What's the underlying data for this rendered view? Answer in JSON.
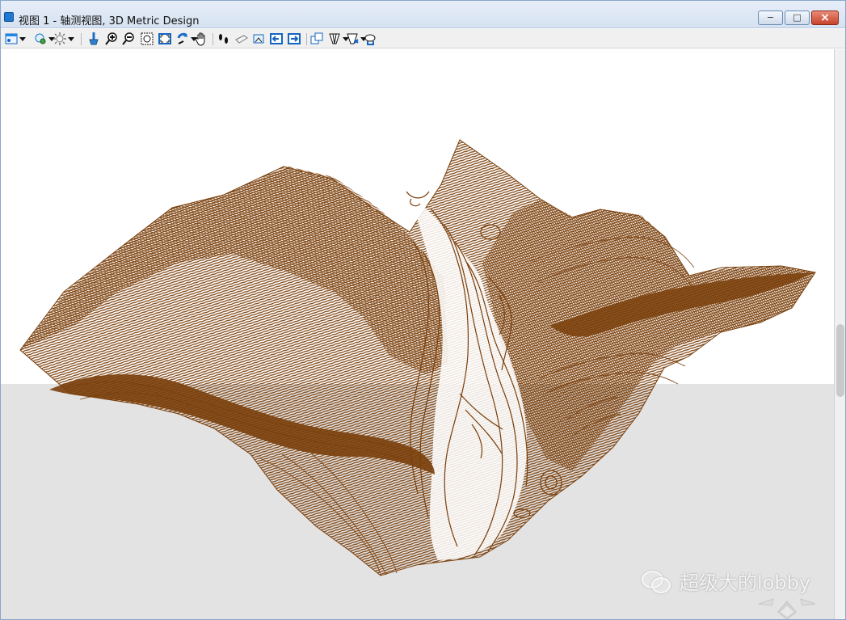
{
  "window": {
    "title": "视图 1 - 轴测视图, 3D Metric Design",
    "controls": {
      "minimize": "−",
      "maximize": "□",
      "close": "×"
    }
  },
  "toolbar": {
    "icons": [
      "view-settings-icon",
      "view-display-icon",
      "brightness-icon",
      "clear-icon",
      "zoom-in-icon",
      "zoom-out-icon",
      "window-area-icon",
      "fit-view-icon",
      "rotate-view-icon",
      "pan-icon",
      "walk-icon",
      "camera-icon",
      "view-previous-icon",
      "view-back-icon",
      "view-forward-icon",
      "copy-view-icon",
      "view-frustum-icon",
      "clip-icon",
      "clip-volume-icon"
    ]
  },
  "watermark": {
    "text": "超级大的lobby"
  },
  "colors": {
    "terrain": "#7a3f0b",
    "ground": "#e3e3e3",
    "titlebar": "#dbe6f3",
    "toolbar": "#f0f0f0"
  }
}
